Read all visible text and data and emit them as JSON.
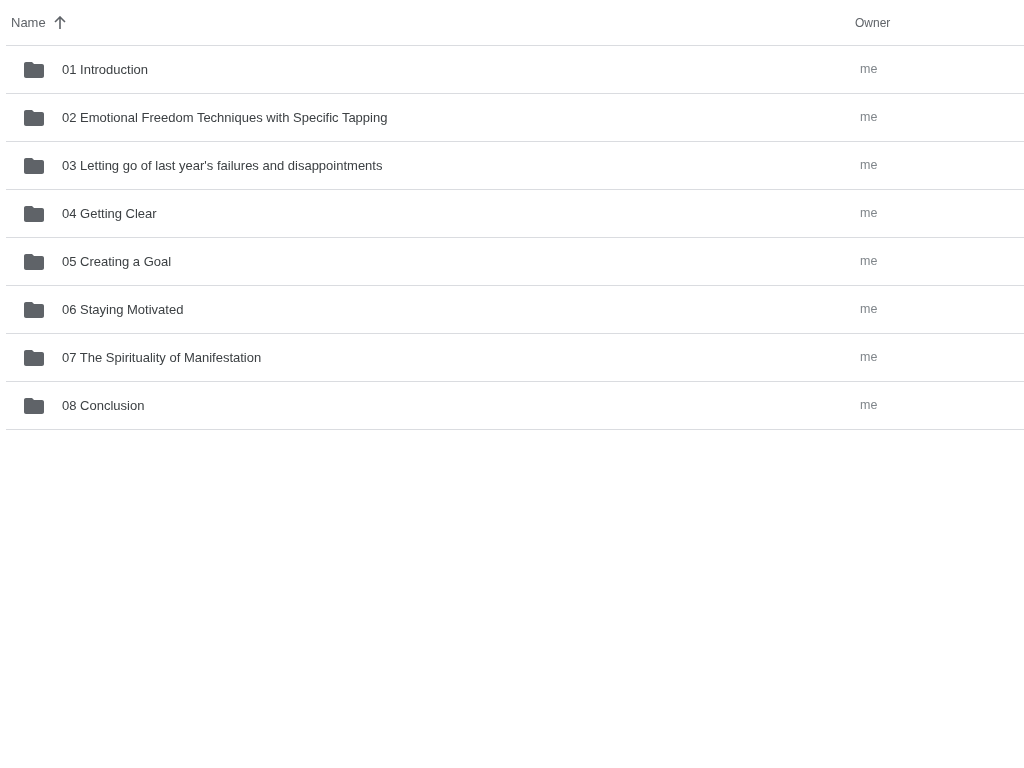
{
  "table": {
    "columns": [
      {
        "label": "Name",
        "sorted": true,
        "ascending": true
      },
      {
        "label": "Owner"
      }
    ],
    "rows": [
      {
        "name": "01 Introduction",
        "owner": "me"
      },
      {
        "name": "02 Emotional Freedom Techniques with Specific Tapping",
        "owner": "me"
      },
      {
        "name": "03 Letting go of last year's failures and disappointments",
        "owner": "me"
      },
      {
        "name": "04 Getting Clear",
        "owner": "me"
      },
      {
        "name": "05 Creating a Goal",
        "owner": "me"
      },
      {
        "name": "06 Staying Motivated",
        "owner": "me"
      },
      {
        "name": "07 The Spirituality of Manifestation",
        "owner": "me"
      },
      {
        "name": "08 Conclusion",
        "owner": "me"
      }
    ]
  }
}
